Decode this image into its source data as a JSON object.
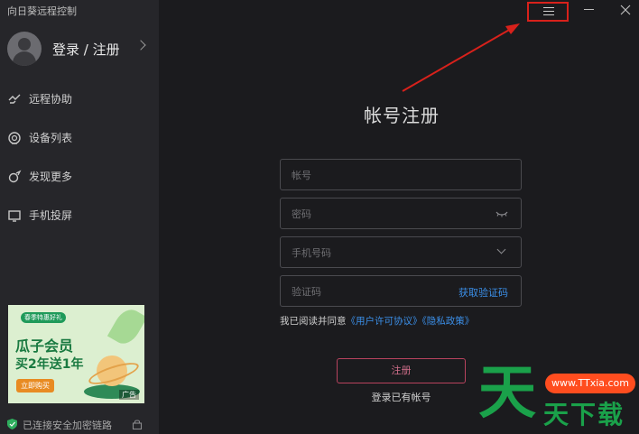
{
  "app": {
    "title": "向日葵远程控制"
  },
  "user": {
    "login_label": "登录 / 注册"
  },
  "sidebar": {
    "items": [
      {
        "label": "远程协助",
        "icon": "remote-assist-icon"
      },
      {
        "label": "设备列表",
        "icon": "device-list-icon"
      },
      {
        "label": "发现更多",
        "icon": "discover-icon"
      },
      {
        "label": "手机投屏",
        "icon": "screen-cast-icon"
      }
    ]
  },
  "ad": {
    "tag": "春季特惠好礼",
    "line1": "瓜子会员",
    "line2": "买2年送1年",
    "button": "立即购买",
    "ad_label": "广告"
  },
  "status": {
    "secure_text": "已连接安全加密链路"
  },
  "form": {
    "title": "帐号注册",
    "account_placeholder": "帐号",
    "password_placeholder": "密码",
    "phone_placeholder": "手机号码",
    "code_placeholder": "验证码",
    "get_code": "获取验证码",
    "agree_text": "我已阅读并同意",
    "user_agreement": "《用户许可协议》",
    "privacy_policy": "《隐私政策》",
    "register_button": "注册",
    "login_link": "登录已有帐号"
  },
  "watermark": {
    "big_char": "天",
    "text": "天下载",
    "badge": "www.TTxia.com"
  },
  "colors": {
    "accent_link": "#3b8fe8",
    "register_border": "#b8435e",
    "annotation_red": "#d8211b",
    "watermark_green": "#1aa14a"
  }
}
